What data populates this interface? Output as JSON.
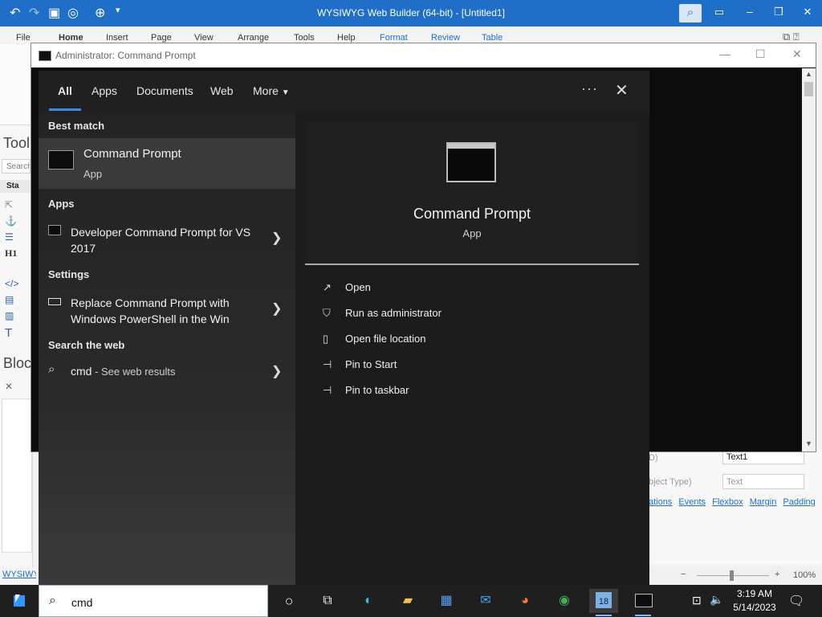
{
  "app": {
    "title": "WYSIWYG Web Builder (64-bit) - [Untitled1]",
    "ribbon_tabs": [
      "File",
      "Home",
      "Insert",
      "Page",
      "View",
      "Arrange",
      "Tools",
      "Help",
      "Format",
      "Review",
      "Table"
    ],
    "left_headings": [
      "Tool",
      "Bloc"
    ],
    "left_search": "Search",
    "left_section": "Sta",
    "status_link": "WYSIWYG",
    "zoom": "100%",
    "properties": [
      {
        "label": "D)",
        "value": "Text1"
      },
      {
        "label": "bject Type)",
        "value": "Text"
      }
    ],
    "prop_links": [
      "ations",
      "Events",
      "Flexbox",
      "Margin",
      "Padding"
    ]
  },
  "cmd_window": {
    "title": "Administrator:  Command Prompt"
  },
  "search": {
    "tabs": [
      "All",
      "Apps",
      "Documents",
      "Web",
      "More"
    ],
    "sections": {
      "best_match": "Best match",
      "apps": "Apps",
      "settings": "Settings",
      "web": "Search the web"
    },
    "best": {
      "title": "Command Prompt",
      "subtitle": "App"
    },
    "app_result": {
      "title": "Developer Command Prompt for VS 2017"
    },
    "settings_result": {
      "title": "Replace Command Prompt with Windows PowerShell in the Win"
    },
    "web_result": {
      "query": "cmd",
      "suffix": " - See web results"
    },
    "preview": {
      "name": "Command Prompt",
      "type": "App",
      "actions": [
        "Open",
        "Run as administrator",
        "Open file location",
        "Pin to Start",
        "Pin to taskbar"
      ]
    }
  },
  "taskbar": {
    "search_value": "cmd",
    "time": "3:19 AM",
    "date": "5/14/2023",
    "badge": "18"
  },
  "colors": {
    "accent": "#1f6fc8",
    "flyout_bg": "#1c1c1c",
    "taskbar": "#1f1f1f"
  }
}
